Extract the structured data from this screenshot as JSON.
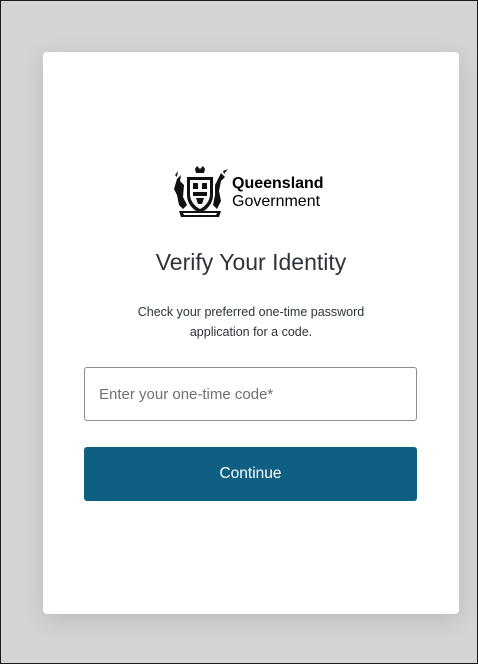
{
  "logo": {
    "line1": "Queensland",
    "line2": "Government"
  },
  "heading": "Verify Your Identity",
  "description": "Check your preferred one-time password application for a code.",
  "otp_input": {
    "placeholder": "Enter your one-time code*",
    "value": ""
  },
  "continue_label": "Continue",
  "colors": {
    "page_background": "#d4d4d4",
    "card_background": "#ffffff",
    "button_background": "#0e5f82",
    "button_text": "#ffffff",
    "text": "#2d333a"
  }
}
